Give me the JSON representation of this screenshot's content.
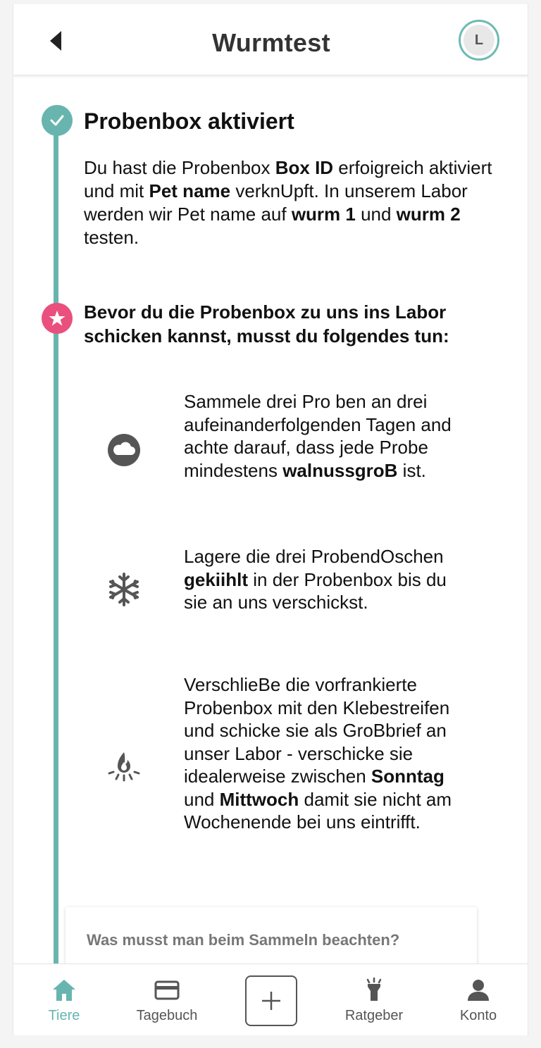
{
  "header": {
    "title": "Wurmtest",
    "avatar_initial": "L"
  },
  "section": {
    "title": "Probenbox aktiviert",
    "intro": {
      "p1": "Du hast die Probenbox ",
      "box_id": "Box ID",
      "p2": " erfoigreich aktiviert und mit ",
      "pet_name": "Pet name",
      "p3": " verknUpft. In unserem Labor werden wir Pet name auf ",
      "wurm1": "wurm 1",
      "p4": " und ",
      "wurm2": "wurm 2",
      "p5": " testen."
    }
  },
  "notice": "Bevor du die Probenbox zu uns ins Labor schicken kannst, musst du folgendes tun:",
  "steps": [
    {
      "icon": "cloud-icon",
      "t1": "Sammele drei Pro ben an drei aufeinanderfolgenden Tagen and achte darauf, dass jede Probe mindestens ",
      "b1": "walnussgroB",
      "t2": " ist."
    },
    {
      "icon": "snowflake-icon",
      "t1": "Lagere die drei ProbendOschen ",
      "b1": "gekiihlt",
      "t2": " in der Probenbox bis du sie an uns verschickst."
    },
    {
      "icon": "fire-icon",
      "t1": "VerschlieBe die vorfrankierte Probenbox mit den Klebestreifen und schicke sie als GroBbrief an unser Labor - verschicke sie idealerweise zwischen ",
      "b1": "Sonntag",
      "t2": " und ",
      "b2": "Mittwoch",
      "t3": " damit sie nicht am Wochenende bei uns eintrifft."
    }
  ],
  "faq": {
    "question": "Was musst man beim Sammeln beachten?"
  },
  "nav": {
    "tiere": "Tiere",
    "tagebuch": "Tagebuch",
    "ratgeber": "Ratgeber",
    "konto": "Konto"
  },
  "colors": {
    "accent": "#67b5ae",
    "star": "#e9507d",
    "text": "#111111"
  }
}
